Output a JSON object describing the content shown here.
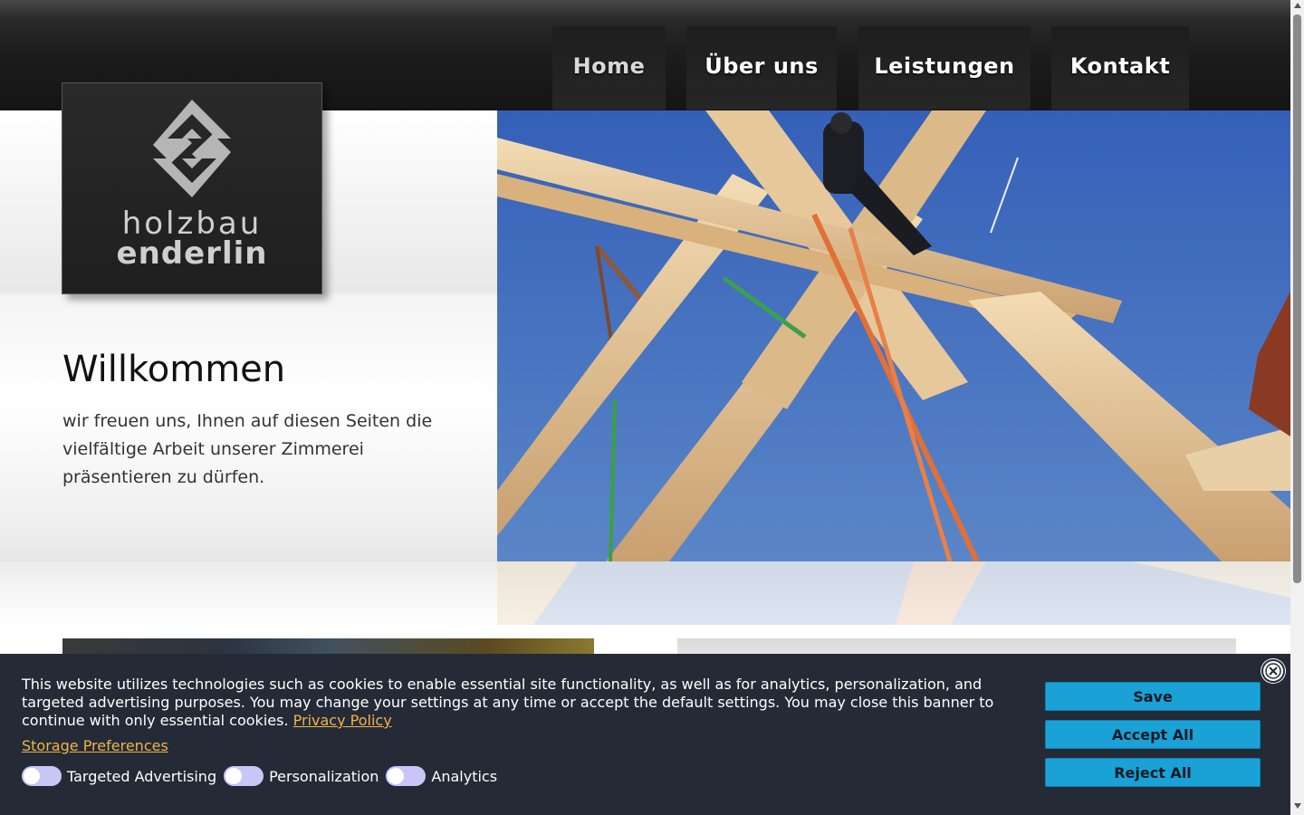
{
  "nav": {
    "items": [
      {
        "label": "Home",
        "active": true
      },
      {
        "label": "Über uns",
        "active": false
      },
      {
        "label": "Leistungen",
        "active": false
      },
      {
        "label": "Kontakt",
        "active": false
      }
    ]
  },
  "logo": {
    "line1": "holzbau",
    "line2": "enderlin"
  },
  "hero": {
    "title": "Willkommen",
    "intro": "wir freuen uns, Ihnen auf diesen Seiten die vielfältige Arbeit unserer Zimmerei präsentieren zu dürfen."
  },
  "cookie_banner": {
    "text": "This website utilizes technologies such as cookies to enable essential site functionality, as well as for analytics, personalization, and targeted advertising purposes. You may change your settings at any time or accept the default settings. You may close this banner to continue with only essential cookies.",
    "privacy_link": "Privacy Policy",
    "storage_link": "Storage Preferences",
    "toggles": [
      {
        "label": "Targeted Advertising"
      },
      {
        "label": "Personalization"
      },
      {
        "label": "Analytics"
      }
    ],
    "buttons": {
      "save": "Save",
      "accept": "Accept All",
      "reject": "Reject All"
    }
  },
  "colors": {
    "banner_bg": "#242b36",
    "button_bg": "#1aa1d6",
    "link": "#f0b44a",
    "toggle_off": "#c7c6f7"
  }
}
